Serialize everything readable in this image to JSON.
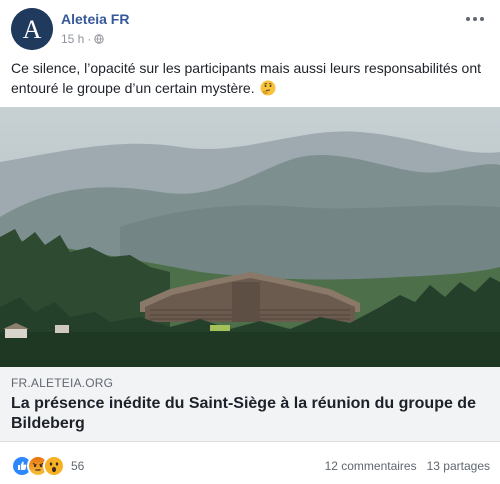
{
  "post": {
    "page_name": "Aleteia FR",
    "time": "15 h",
    "separator": "·",
    "privacy_icon": "globe-icon",
    "text": "Ce silence, l’opacité sur les participants mais aussi leurs responsabilités ont entouré le groupe d’un certain mystère.",
    "emoji_icon": "thinking-face-emoji"
  },
  "link_preview": {
    "domain": "FR.ALETEIA.ORG",
    "title": "La présence inédite du Saint-Siège à la réunion du groupe de Bildeberg"
  },
  "engagement": {
    "reactions": [
      "like",
      "angry",
      "wow"
    ],
    "reaction_count": "56",
    "comments": "12 commentaires",
    "shares": "13 partages"
  },
  "colors": {
    "page_name": "#365899",
    "like": "#2d88ff",
    "angry": "#e9710f",
    "wow": "#f7b125"
  }
}
